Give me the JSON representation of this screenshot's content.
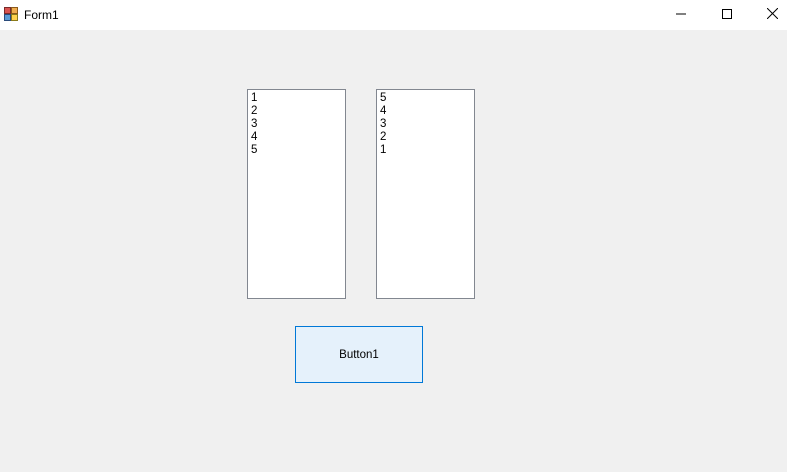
{
  "window": {
    "title": "Form1",
    "background": "#f0f0f0",
    "controls": {
      "minimize_icon": "minimize-icon",
      "maximize_icon": "maximize-icon",
      "close_icon": "close-icon"
    }
  },
  "listbox1": {
    "items": [
      "1",
      "2",
      "3",
      "4",
      "5"
    ]
  },
  "listbox2": {
    "items": [
      "5",
      "4",
      "3",
      "2",
      "1"
    ]
  },
  "button1": {
    "label": "Button1",
    "background": "#e5f1fb",
    "border": "#0078d7"
  }
}
